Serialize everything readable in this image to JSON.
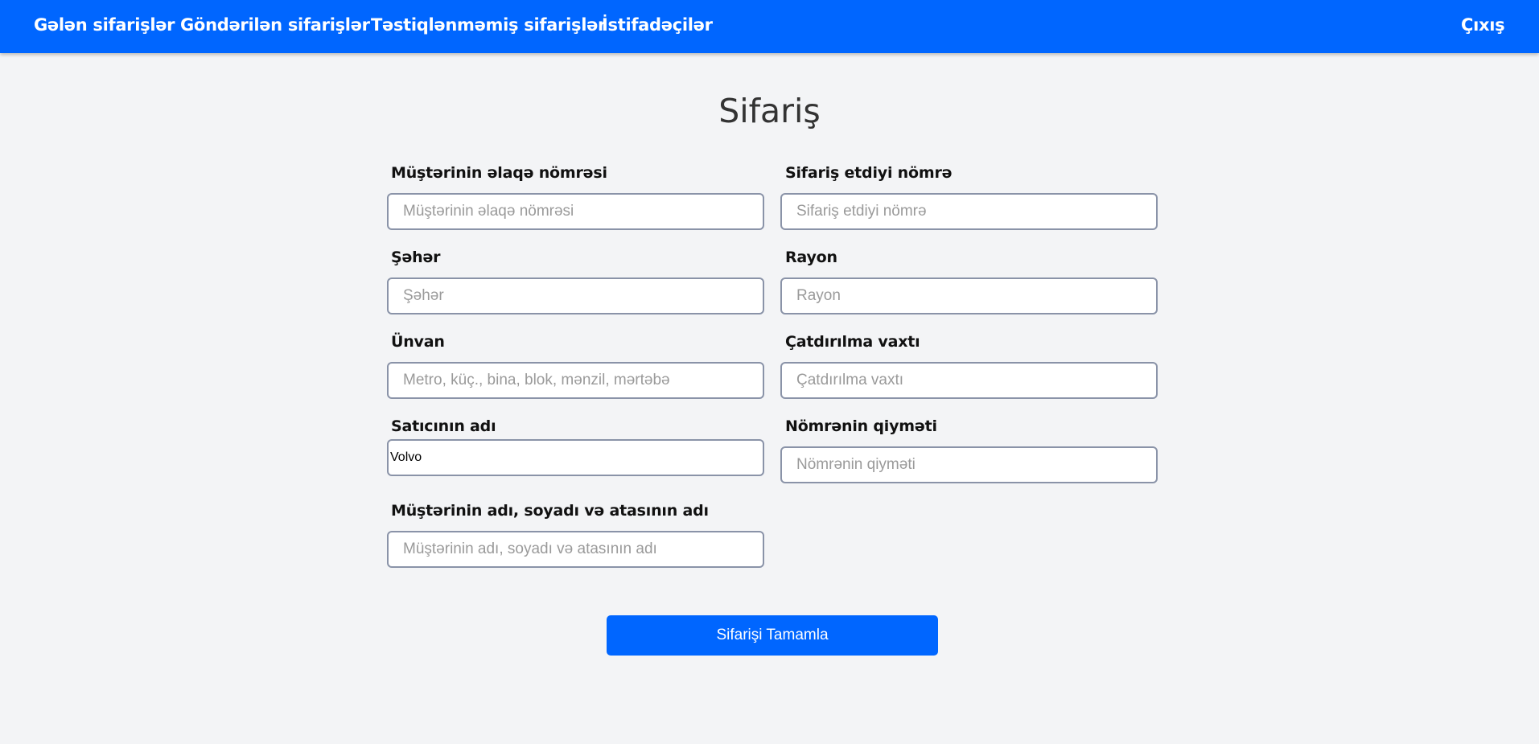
{
  "nav": {
    "links": [
      {
        "label": "Gələn sifarişlər"
      },
      {
        "label": "Göndərilən sifarişlər"
      },
      {
        "label": "Təstiqlənməmiş sifarişlər"
      },
      {
        "label": "İstifadəçilər"
      }
    ],
    "logout": "Çıxış"
  },
  "page": {
    "title": "Sifariş"
  },
  "form": {
    "customer_phone": {
      "label": "Müştərinin əlaqə nömrəsi",
      "placeholder": "Müştərinin əlaqə nömrəsi",
      "value": ""
    },
    "ordered_number": {
      "label": "Sifariş etdiyi nömrə",
      "placeholder": "Sifariş etdiyi nömrə",
      "value": ""
    },
    "city": {
      "label": "Şəhər",
      "placeholder": "Şəhər",
      "value": ""
    },
    "district": {
      "label": "Rayon",
      "placeholder": "Rayon",
      "value": ""
    },
    "address": {
      "label": "Ünvan",
      "placeholder": "Metro, küç., bina, blok, mənzil, mərtəbə",
      "value": ""
    },
    "delivery_time": {
      "label": "Çatdırılma vaxtı",
      "placeholder": "Çatdırılma vaxtı",
      "value": ""
    },
    "seller_name": {
      "label": "Satıcının adı",
      "placeholder": "",
      "value": "Volvo"
    },
    "number_price": {
      "label": "Nömrənin qiyməti",
      "placeholder": "Nömrənin qiyməti",
      "value": ""
    },
    "customer_full_name": {
      "label": "Müştərinin adı, soyadı və atasının adı",
      "placeholder": "Müştərinin adı, soyadı və atasının adı",
      "value": ""
    },
    "submit_label": "Sifarişi Tamamla"
  },
  "colors": {
    "primary": "#0066ff",
    "background": "#f3f4f6",
    "input_border": "#8a93a8"
  }
}
